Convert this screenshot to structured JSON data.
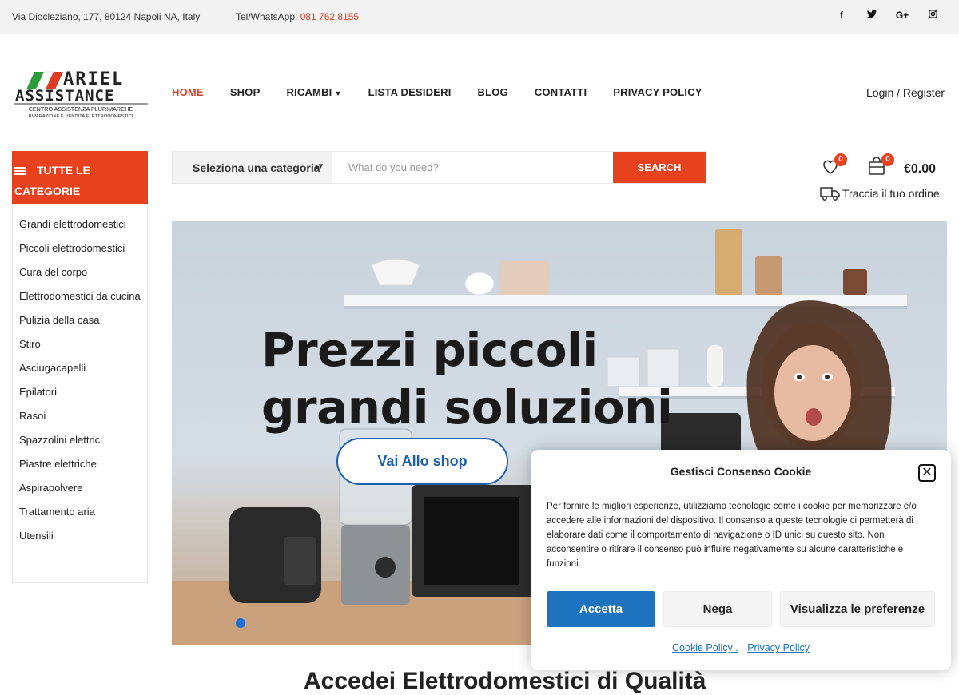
{
  "topbar": {
    "address": "Via Diocleziano, 177, 80124 Napoli NA, Italy",
    "tel_label": "Tel/WhatsApp: ",
    "tel_number": "081 762 8155",
    "social": [
      {
        "icon": "facebook-icon",
        "glyph": "f"
      },
      {
        "icon": "twitter-icon",
        "glyph": "🐦"
      },
      {
        "icon": "google-plus-icon",
        "glyph": "G+"
      },
      {
        "icon": "instagram-icon",
        "glyph": "◎"
      }
    ]
  },
  "logo": {
    "line1": "ARIEL",
    "line2": "ASSISTANCE",
    "tagline1": "CENTRO ASSISTENZA PLURIMARCHE",
    "tagline2": "RIPARAZIONE E VENDITA ELETTRODOMESTICI"
  },
  "nav": {
    "home": "HOME",
    "shop": "SHOP",
    "ricambi": "RICAMBI",
    "wishlist": "LISTA DESIDERI",
    "blog": "BLOG",
    "contatti": "CONTATTI",
    "privacy": "PRIVACY POLICY",
    "login": "Login / Register"
  },
  "categories": {
    "heading": "TUTTE LE CATEGORIE",
    "items": [
      "Grandi elettrodomestici",
      "Piccoli elettrodomestici",
      "Cura del corpo",
      "Elettrodomestici da cucina",
      "Pulizia della casa",
      "Stiro",
      "Asciugacapelli",
      "Epilatori",
      "Rasoi",
      "Spazzolini elettrici",
      "Piastre elettriche",
      "Aspirapolvere",
      "Trattamento aria",
      "Utensili"
    ]
  },
  "search": {
    "category_select": "Seleziona una categoria",
    "placeholder": "What do you need?",
    "button": "SEARCH"
  },
  "header_icons": {
    "wishlist_count": "0",
    "cart_count": "0",
    "cart_total": "€0.00",
    "track_order": "Traccia il tuo ordine"
  },
  "hero": {
    "headline_line1": "Prezzi piccoli",
    "headline_line2": "grandi soluzioni",
    "cta": "Vai Allo shop"
  },
  "below": {
    "section_title": "Accedei Elettrodomestici di Qualità"
  },
  "cookie": {
    "title": "Gestisci Consenso Cookie",
    "text": "Per fornire le migliori esperienze, utilizziamo tecnologie come i cookie per memorizzare e/o accedere alle informazioni del dispositivo. Il consenso a queste tecnologie ci permetterà di elaborare dati come il comportamento di navigazione o ID unici su questo sito. Non acconsentire o ritirare il consenso può influire negativamente su alcune caratteristiche e funzioni.",
    "accept": "Accetta",
    "deny": "Nega",
    "preferences": "Visualizza le preferenze",
    "cookie_policy": "Cookie Policy .",
    "privacy_policy": "Privacy Policy"
  },
  "colors": {
    "accent": "#e8411e",
    "link_blue": "#1e73be",
    "topbar_bg": "#f3f3f3"
  }
}
